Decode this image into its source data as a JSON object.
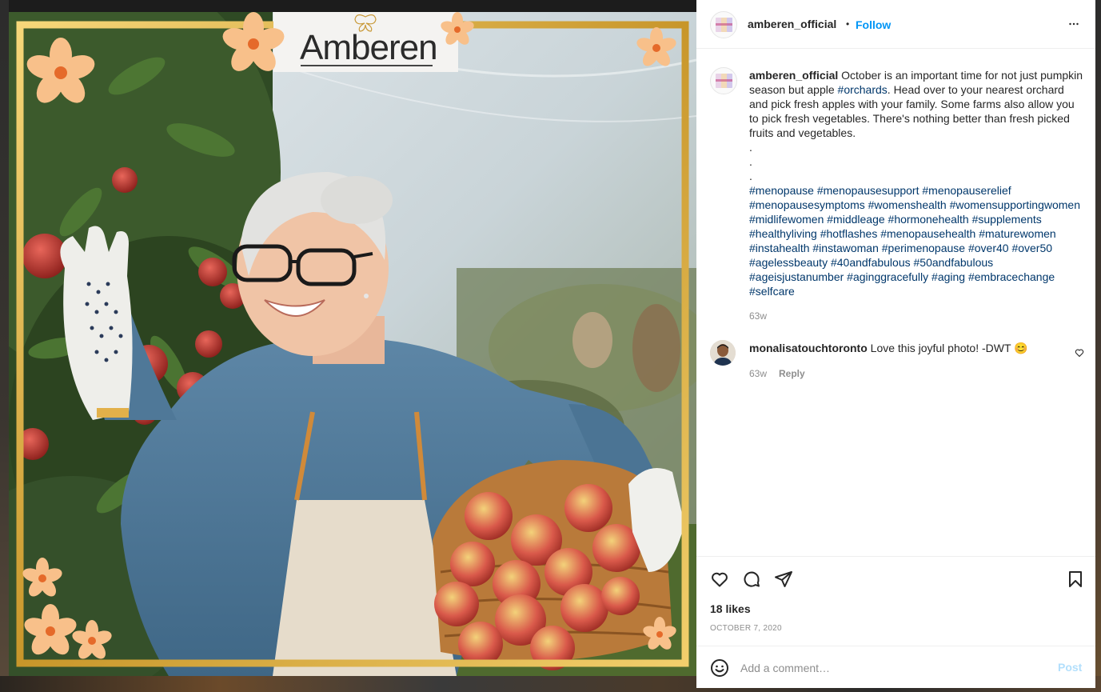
{
  "post": {
    "image": {
      "brand_logo_text": "Amberen",
      "scene": "photo"
    },
    "header": {
      "username": "amberen_official",
      "separator": "•",
      "follow_label": "Follow",
      "more_icon": "more-horizontal-icon"
    },
    "caption": {
      "username": "amberen_official",
      "text_before_tag": " October is an important time for not just pumpkin season but apple ",
      "inline_tag": "#orchards",
      "text_after_tag": ". Head over to your nearest orchard and pick fresh apples with your family. Some farms also allow you to pick fresh vegetables. There's nothing better than fresh picked fruits and vegetables.",
      "dots": [
        ".",
        ".",
        "."
      ],
      "hashtags": "#menopause #menopausesupport #menopauserelief #menopausesymptoms #womenshealth #womensupportingwomen #midlifewomen #middleage #hormonehealth #supplements #healthyliving #hotflashes #menopausehealth #maturewomen #instahealth #instawoman #perimenopause #over40 #over50 #agelessbeauty #40andfabulous #50andfabulous #ageisjustanumber #aginggracefully #aging #embracechange #selfcare",
      "time": "63w"
    },
    "comments": [
      {
        "username": "monalisatouchtoronto",
        "text": " Love this joyful photo! -DWT 😊",
        "time": "63w",
        "reply_label": "Reply"
      }
    ],
    "actions": {
      "icons": [
        "heart-icon",
        "comment-icon",
        "share-icon",
        "bookmark-icon"
      ]
    },
    "likes": "18 likes",
    "date": "OCTOBER 7, 2020",
    "add_comment": {
      "placeholder": "Add a comment…",
      "post_label": "Post",
      "emoji_icon": "emoji-icon"
    }
  }
}
